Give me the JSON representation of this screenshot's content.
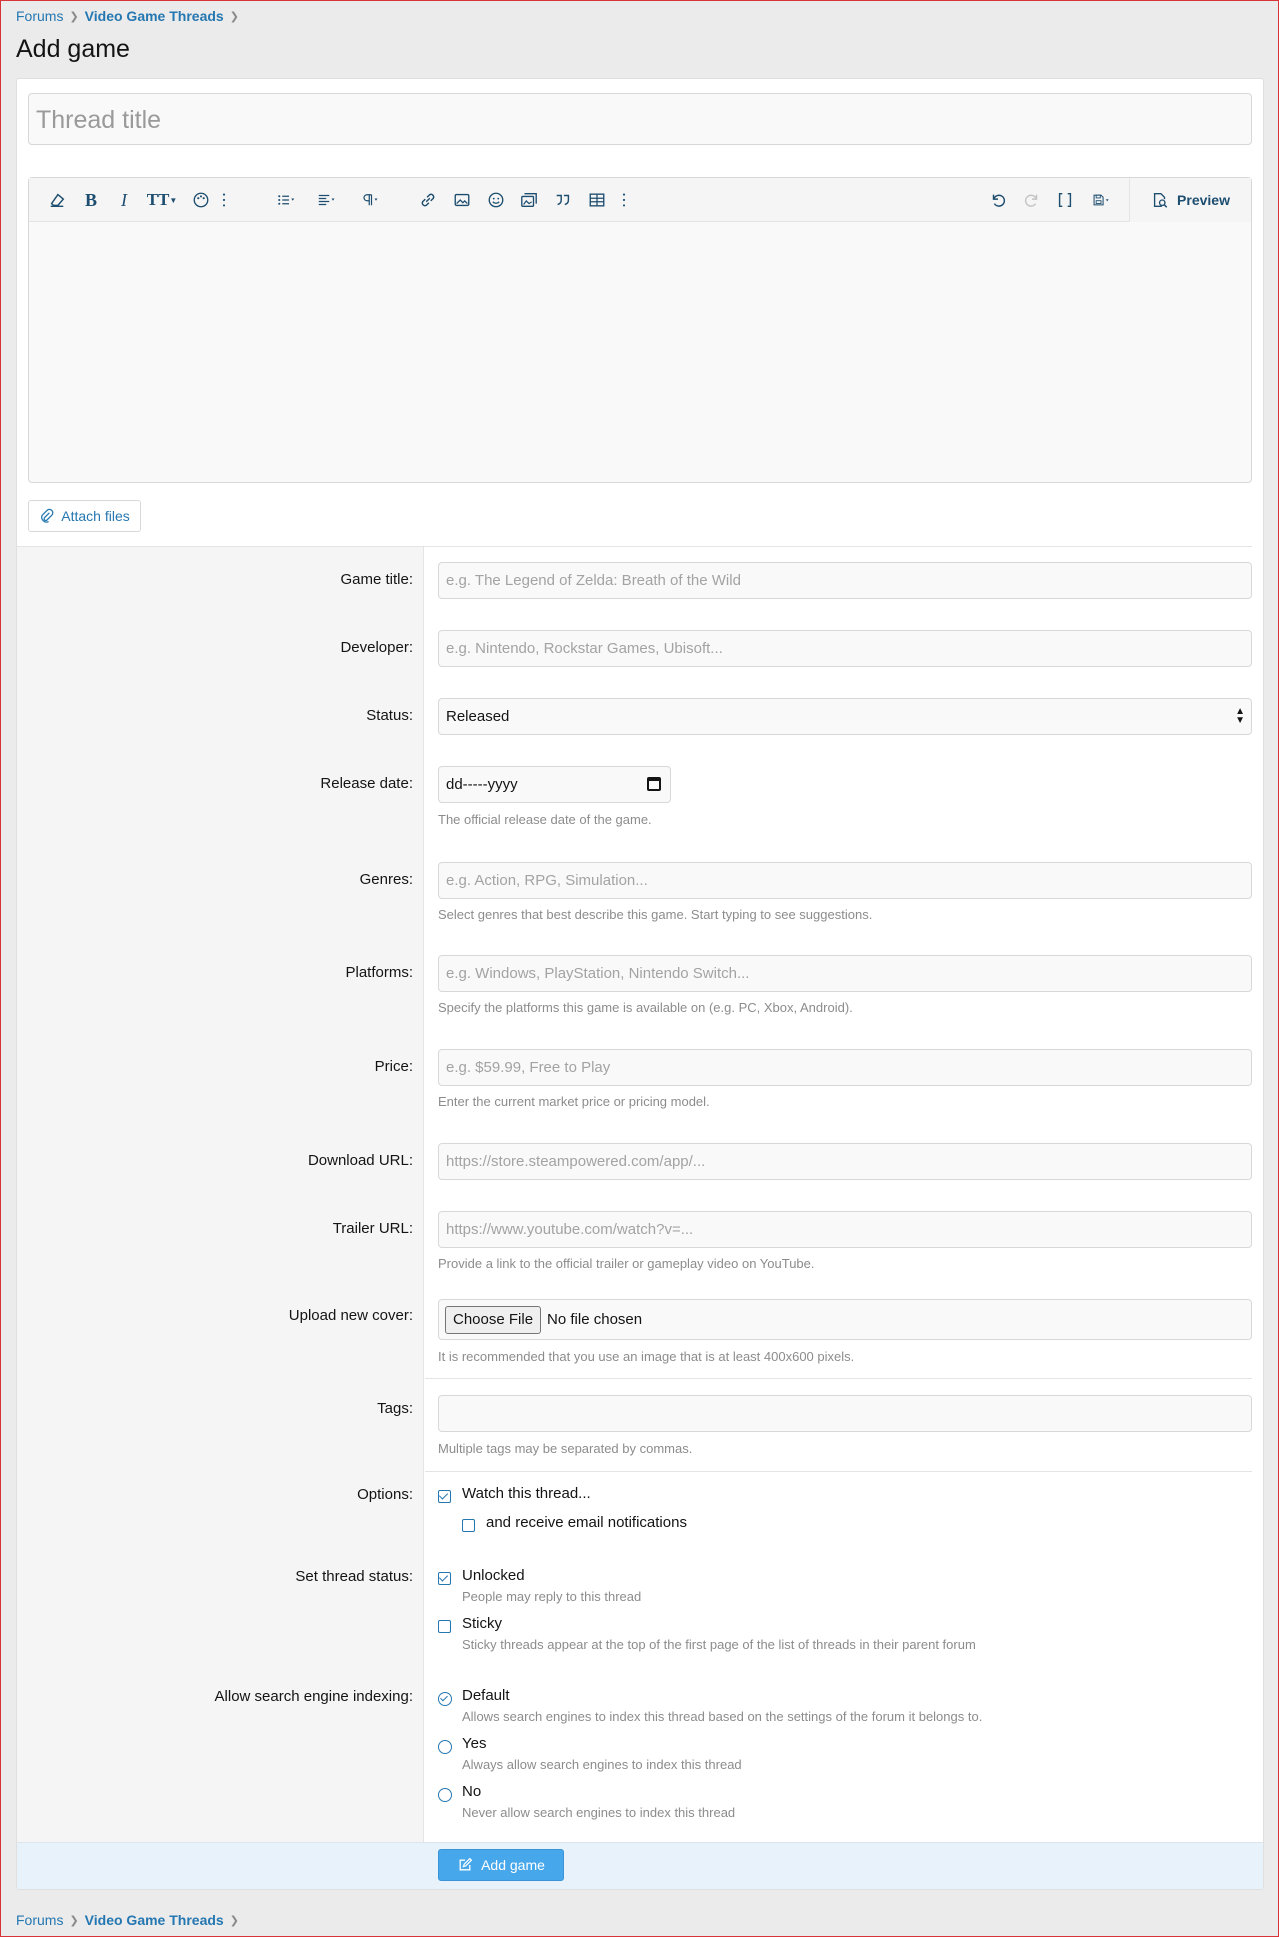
{
  "breadcrumb": {
    "root": "Forums",
    "section": "Video Game Threads"
  },
  "page": {
    "title": "Add game"
  },
  "thread_title": {
    "placeholder": "Thread title"
  },
  "editor": {
    "toolbar_icons": [
      "eraser-icon",
      "bold-icon",
      "italic-icon",
      "font-size-icon",
      "palette-icon",
      "more-icon",
      "list-icon",
      "align-icon",
      "paragraph-icon",
      "link-icon",
      "image-icon",
      "smiley-icon",
      "media-icon",
      "quote-icon",
      "table-icon",
      "more-icon",
      "undo-icon",
      "redo-icon",
      "bbcode-icon",
      "drafts-icon"
    ],
    "preview_label": "Preview"
  },
  "attach": {
    "label": "Attach files"
  },
  "fields": {
    "game_title": {
      "label": "Game title:",
      "placeholder": "e.g. The Legend of Zelda: Breath of the Wild"
    },
    "developer": {
      "label": "Developer:",
      "placeholder": "e.g. Nintendo, Rockstar Games, Ubisoft..."
    },
    "status": {
      "label": "Status:",
      "value": "Released"
    },
    "release_date": {
      "label": "Release date:",
      "value": "dd-----yyyy",
      "hint": "The official release date of the game."
    },
    "genres": {
      "label": "Genres:",
      "placeholder": "e.g. Action, RPG, Simulation...",
      "hint": "Select genres that best describe this game. Start typing to see suggestions."
    },
    "platforms": {
      "label": "Platforms:",
      "placeholder": "e.g. Windows, PlayStation, Nintendo Switch...",
      "hint": "Specify the platforms this game is available on (e.g. PC, Xbox, Android)."
    },
    "price": {
      "label": "Price:",
      "placeholder": "e.g. $59.99, Free to Play",
      "hint": "Enter the current market price or pricing model."
    },
    "download_url": {
      "label": "Download URL:",
      "placeholder": "https://store.steampowered.com/app/..."
    },
    "trailer_url": {
      "label": "Trailer URL:",
      "placeholder": "https://www.youtube.com/watch?v=...",
      "hint": "Provide a link to the official trailer or gameplay video on YouTube."
    },
    "cover": {
      "label": "Upload new cover:",
      "button": "Choose File",
      "value": "No file chosen",
      "hint": "It is recommended that you use an image that is at least 400x600 pixels."
    },
    "tags": {
      "label": "Tags:",
      "hint": "Multiple tags may be separated by commas."
    }
  },
  "options": {
    "label": "Options:",
    "watch": "Watch this thread...",
    "email": "and receive email notifications"
  },
  "thread_status": {
    "label": "Set thread status:",
    "unlocked": "Unlocked",
    "unlocked_hint": "People may reply to this thread",
    "sticky": "Sticky",
    "sticky_hint": "Sticky threads appear at the top of the first page of the list of threads in their parent forum"
  },
  "indexing": {
    "label": "Allow search engine indexing:",
    "default": "Default",
    "default_hint": "Allows search engines to index this thread based on the settings of the forum it belongs to.",
    "yes": "Yes",
    "yes_hint": "Always allow search engines to index this thread",
    "no": "No",
    "no_hint": "Never allow search engines to index this thread"
  },
  "submit": {
    "label": "Add game"
  },
  "colors": {
    "accent": "#2577b1",
    "button": "#47a7eb",
    "footer_bar": "#e8f2fb"
  }
}
